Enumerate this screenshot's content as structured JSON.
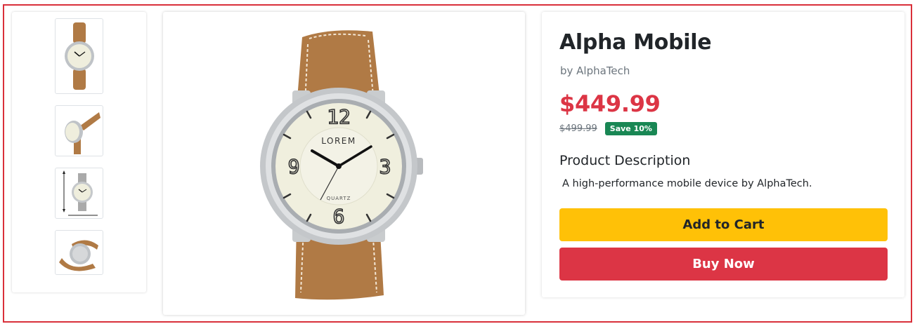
{
  "product": {
    "title": "Alpha Mobile",
    "brand": "by AlphaTech",
    "price": "$449.99",
    "original_price": "$499.99",
    "save_badge": "Save 10%",
    "description_heading": "Product Description",
    "description": "A high-performance mobile device by AlphaTech."
  },
  "actions": {
    "add_to_cart": "Add to Cart",
    "buy_now": "Buy Now"
  },
  "watch": {
    "logo_text": "LOREM",
    "sub_text": "QUARTZ",
    "numerals": [
      "12",
      "3",
      "6",
      "9"
    ]
  },
  "thumbnails": [
    {
      "name": "thumbnail-front"
    },
    {
      "name": "thumbnail-side"
    },
    {
      "name": "thumbnail-dimensions"
    },
    {
      "name": "thumbnail-back"
    }
  ],
  "colors": {
    "price": "#dc3545",
    "save_badge": "#198754",
    "add_to_cart": "#ffc107",
    "buy_now": "#dc3545",
    "frame": "#d9303a",
    "strap": "#b07a45"
  }
}
